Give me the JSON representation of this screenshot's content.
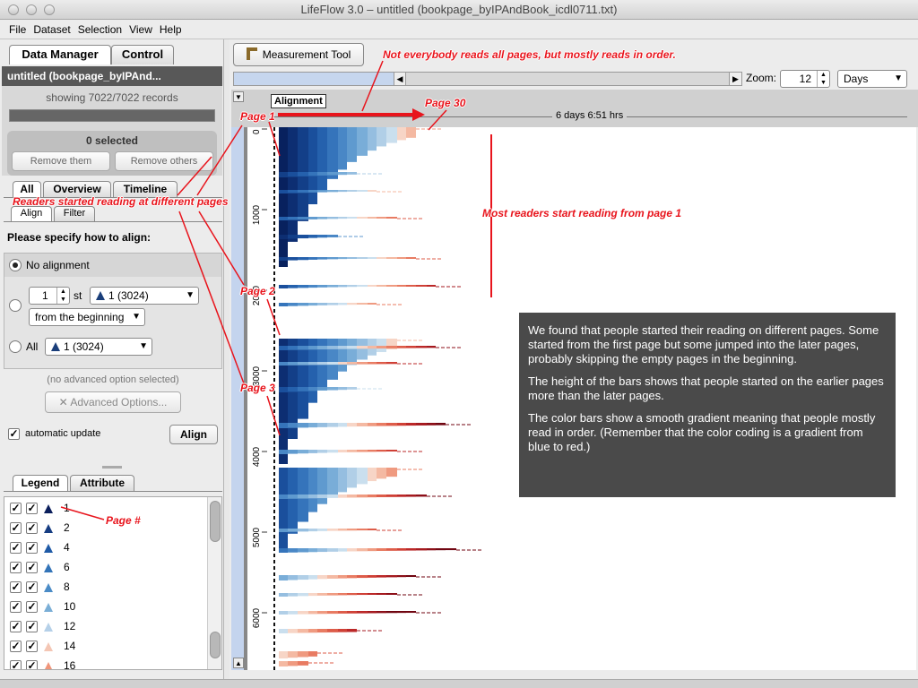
{
  "window": {
    "title": "LifeFlow 3.0 – untitled (bookpage_byIPAndBook_icdl0711.txt)"
  },
  "menu": [
    "File",
    "Dataset",
    "Selection",
    "View",
    "Help"
  ],
  "left": {
    "tabs": [
      "Data Manager",
      "Control"
    ],
    "dataset_title": "untitled (bookpage_byIPAnd...",
    "records_text": "showing 7022/7022 records",
    "selected_text": "0 selected",
    "remove_them": "Remove them",
    "remove_others": "Remove others",
    "subtabs": [
      "All",
      "Overview",
      "Timeline"
    ],
    "subtabs2": [
      "Align",
      "Filter"
    ],
    "align_prompt": "Please specify how to align:",
    "no_alignment": "No alignment",
    "nth_value": "1",
    "nth_suffix": "st",
    "event_select": "1 (3024)",
    "from_select": "from the beginning",
    "all_label": "All",
    "all_select": "1 (3024)",
    "advanced_note": "(no advanced option selected)",
    "advanced_button": "Advanced Options...",
    "auto_update": "automatic update",
    "align_button": "Align",
    "legend_tabs": [
      "Legend",
      "Attribute"
    ],
    "legend_items": [
      {
        "label": "1",
        "color": "#0b1f5c"
      },
      {
        "label": "2",
        "color": "#163d82"
      },
      {
        "label": "4",
        "color": "#1f5aa6"
      },
      {
        "label": "6",
        "color": "#3374b8"
      },
      {
        "label": "8",
        "color": "#4a8bc6"
      },
      {
        "label": "10",
        "color": "#7aaed6"
      },
      {
        "label": "12",
        "color": "#b5d0e8"
      },
      {
        "label": "14",
        "color": "#f4c6b4"
      },
      {
        "label": "16",
        "color": "#f0957a"
      }
    ]
  },
  "toolbar": {
    "measurement_tool": "Measurement Tool",
    "zoom_label": "Zoom:",
    "zoom_value": "12",
    "zoom_unit": "Days"
  },
  "chart": {
    "alignment_label": "Alignment",
    "duration_label": "6 days 6:51 hrs",
    "y_ticks": [
      "0",
      "1000",
      "2000",
      "3000",
      "4000",
      "5000",
      "6000"
    ]
  },
  "annotations": {
    "top_note": "Not everybody reads all pages, but mostly reads in order.",
    "page30": "Page 30",
    "page1": "Page 1",
    "page2": "Page 2",
    "page3": "Page 3",
    "readers_started": "Readers started reading at different pages",
    "most_readers": "Most readers start reading from page 1",
    "page_hash": "Page #"
  },
  "info_box": {
    "p1": "We found that people started their reading on different pages. Some started from the first page but some jumped into the later pages, probably skipping the empty pages in the beginning.",
    "p2": "The height of the bars shows that people started on the earlier pages more than the later pages.",
    "p3": "The color bars show a smooth gradient meaning that people mostly read in order. (Remember that the color coding is a gradient from blue to red.)"
  }
}
